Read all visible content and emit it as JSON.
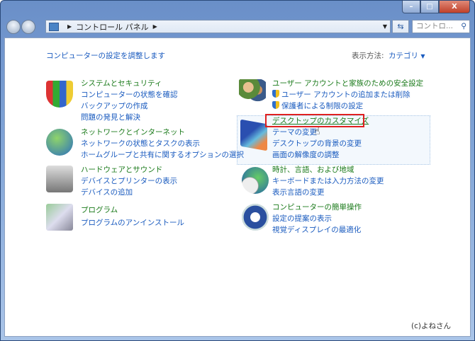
{
  "window": {
    "minimize": "–",
    "maximize": "□",
    "close": "X"
  },
  "address": {
    "path": "コントロール パネル",
    "search_placeholder": "コントロ..."
  },
  "header": {
    "title": "コンピューターの設定を調整します",
    "view_label": "表示方法:",
    "view_value": "カテゴリ"
  },
  "categories": [
    {
      "title": "システムとセキュリティ",
      "links": [
        "コンピューターの状態を確認",
        "バックアップの作成",
        "問題の発見と解決"
      ]
    },
    {
      "title": "ネットワークとインターネット",
      "links": [
        "ネットワークの状態とタスクの表示",
        "ホームグループと共有に関するオプションの選択"
      ]
    },
    {
      "title": "ハードウェアとサウンド",
      "links": [
        "デバイスとプリンターの表示",
        "デバイスの追加"
      ]
    },
    {
      "title": "プログラム",
      "links": [
        "プログラムのアンインストール"
      ]
    },
    {
      "title": "ユーザー アカウントと家族のための安全設定",
      "links": [
        "ユーザー アカウントの追加または削除",
        "保護者による制限の設定"
      ]
    },
    {
      "title": "デスクトップのカスタマイズ",
      "links": [
        "テーマの変更",
        "デスクトップの背景の変更",
        "画面の解像度の調整"
      ]
    },
    {
      "title": "時計、言語、および地域",
      "links": [
        "キーボードまたは入力方法の変更",
        "表示言語の変更"
      ]
    },
    {
      "title": "コンピューターの簡単操作",
      "links": [
        "設定の提案の表示",
        "視覚ディスプレイの最適化"
      ]
    }
  ],
  "watermark": "(c)よねさん"
}
